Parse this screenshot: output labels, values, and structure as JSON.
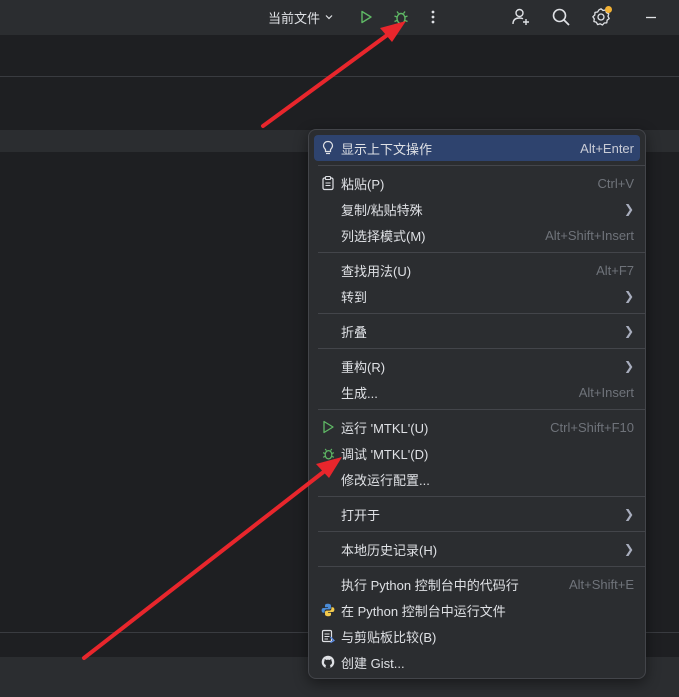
{
  "toolbar": {
    "config_label": "当前文件",
    "icons": [
      "run-icon",
      "debug-icon",
      "more-icon",
      "add-user-icon",
      "search-icon",
      "settings-icon"
    ]
  },
  "menu": {
    "items": [
      {
        "label": "显示上下文操作",
        "shortcut": "Alt+Enter"
      },
      {
        "label": "粘贴(P)",
        "shortcut": "Ctrl+V"
      },
      {
        "label": "复制/粘贴特殊",
        "shortcut": ""
      },
      {
        "label": "列选择模式(M)",
        "shortcut": "Alt+Shift+Insert"
      },
      {
        "label": "查找用法(U)",
        "shortcut": "Alt+F7"
      },
      {
        "label": "转到",
        "shortcut": ""
      },
      {
        "label": "折叠",
        "shortcut": ""
      },
      {
        "label": "重构(R)",
        "shortcut": ""
      },
      {
        "label": "生成...",
        "shortcut": "Alt+Insert"
      },
      {
        "label": "运行 'MTKL'(U)",
        "shortcut": "Ctrl+Shift+F10"
      },
      {
        "label": "调试 'MTKL'(D)",
        "shortcut": ""
      },
      {
        "label": "修改运行配置...",
        "shortcut": ""
      },
      {
        "label": "打开于",
        "shortcut": ""
      },
      {
        "label": "本地历史记录(H)",
        "shortcut": ""
      },
      {
        "label": "执行 Python 控制台中的代码行",
        "shortcut": "Alt+Shift+E"
      },
      {
        "label": "在 Python 控制台中运行文件",
        "shortcut": ""
      },
      {
        "label": "与剪贴板比较(B)",
        "shortcut": ""
      },
      {
        "label": "创建 Gist...",
        "shortcut": ""
      }
    ]
  },
  "colors": {
    "accent_selected": "#2e436e",
    "run_green": "#5fb865",
    "annotation_arrow": "#e8262c",
    "notification_dot": "#f2b134"
  }
}
